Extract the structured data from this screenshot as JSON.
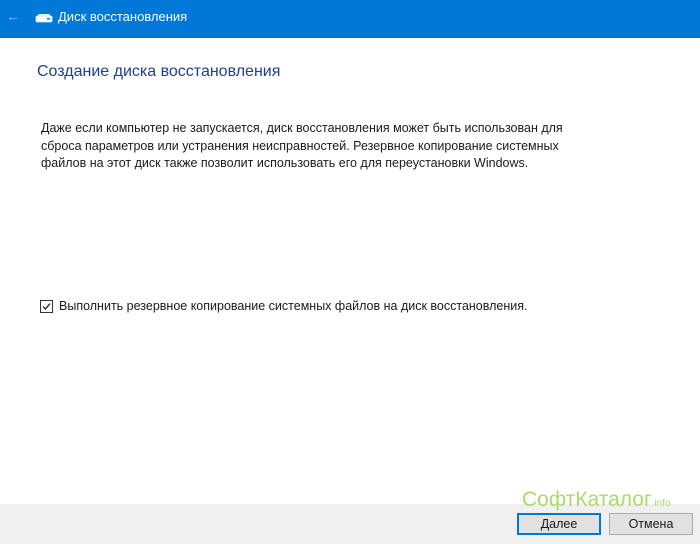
{
  "window": {
    "title": "Диск восстановления",
    "back_icon": "←"
  },
  "main": {
    "heading": "Создание диска восстановления",
    "description_lines": [
      "Даже если компьютер не запускается, диск восстановления может быть использован для",
      "сброса параметров или устранения неисправностей. Резервное копирование системных",
      "файлов на этот диск также позволит использовать его для переустановки Windows."
    ],
    "backup_checkbox": {
      "label": "Выполнить резервное копирование системных файлов на диск восстановления.",
      "checked": true
    }
  },
  "watermark": {
    "text": "СофтКаталог",
    "suffix": ".info"
  },
  "footer": {
    "next_label": "Далее",
    "cancel_label": "Отмена"
  },
  "colors": {
    "titlebar": "#0078d7",
    "heading": "#1e3f8e",
    "watermark": "#a2d85a"
  },
  "icons": {
    "back": "arrow-left-icon",
    "drive": "recovery-drive-icon",
    "check": "checkmark-icon"
  }
}
